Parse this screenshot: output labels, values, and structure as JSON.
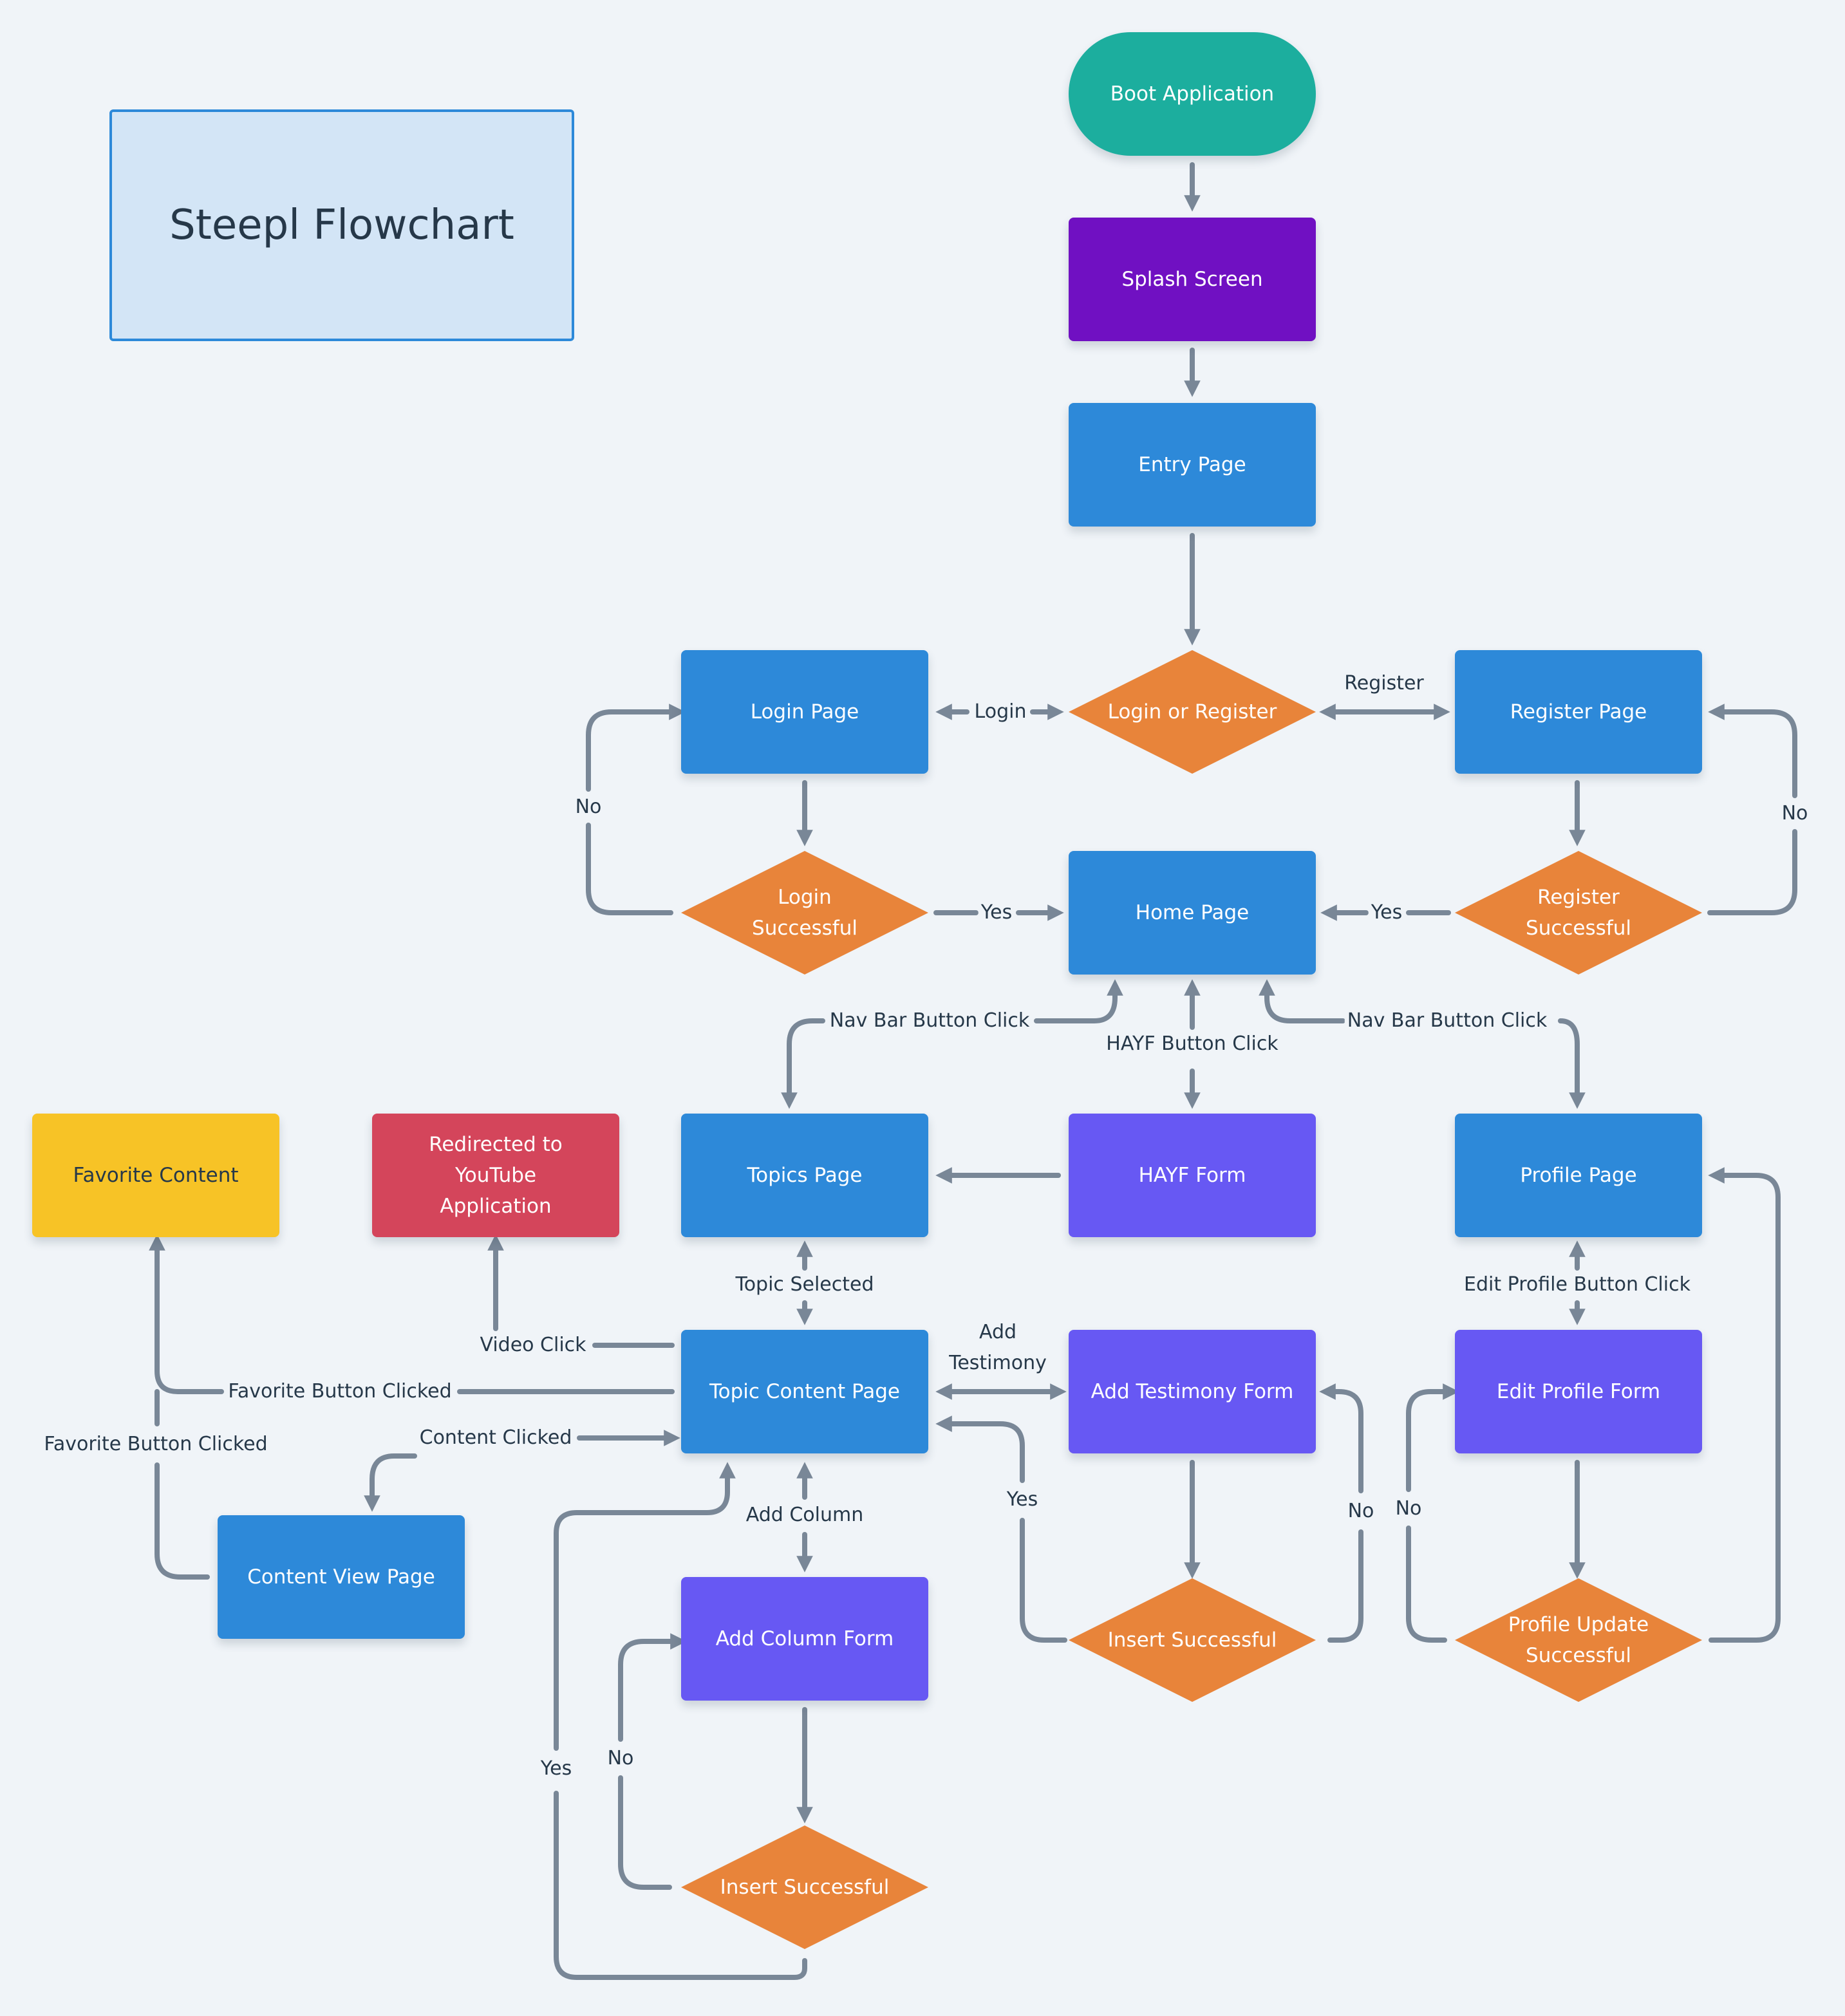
{
  "title": "Steepl Flowchart",
  "colors": {
    "background": "#f0f4f8",
    "start": "#1cae9e",
    "splash": "#7010c2",
    "page": "#2d89d9",
    "form": "#6758f3",
    "decision": "#e8843a",
    "favorite": "#f7c326",
    "external": "#d4455b",
    "edge": "#798797",
    "label_text": "#263849",
    "title_fill": "#d3e5f6",
    "title_border": "#2d89d9"
  },
  "nodes": {
    "boot": "Boot Application",
    "splash": "Splash Screen",
    "entry": "Entry Page",
    "login_or_register": "Login or Register",
    "login_page": "Login Page",
    "register_page": "Register Page",
    "login_successful": "Login Successful",
    "register_successful": "Register Successful",
    "home": "Home Page",
    "topics": "Topics Page",
    "hayf_form": "HAYF Form",
    "profile": "Profile Page",
    "favorite_content": "Favorite Content",
    "youtube": "Redirected to YouTube Application",
    "topic_content": "Topic Content Page",
    "add_testimony_form": "Add Testimony Form",
    "edit_profile_form": "Edit Profile Form",
    "content_view": "Content View Page",
    "add_column_form": "Add Column Form",
    "testimony_insert_successful": "Insert Successful",
    "profile_update_successful": "Profile Update Successful",
    "column_insert_successful": "Insert Successful"
  },
  "edge_labels": {
    "login": "Login",
    "register": "Register",
    "login_no": "No",
    "login_yes": "Yes",
    "register_no": "No",
    "register_yes": "Yes",
    "nav_left": "Nav Bar Button Click",
    "hayf": "HAYF Button Click",
    "nav_right": "Nav Bar Button Click",
    "topic_selected": "Topic Selected",
    "edit_profile_click": "Edit Profile Button Click",
    "video_click": "Video Click",
    "favorite_clicked_1": "Favorite Button Clicked",
    "favorite_clicked_2": "Favorite Button Clicked",
    "content_clicked": "Content Clicked",
    "add_testimony": "Add Testimony",
    "testimony_yes": "Yes",
    "testimony_no": "No",
    "profile_no": "No",
    "add_column": "Add Column",
    "column_yes": "Yes",
    "column_no": "No"
  }
}
